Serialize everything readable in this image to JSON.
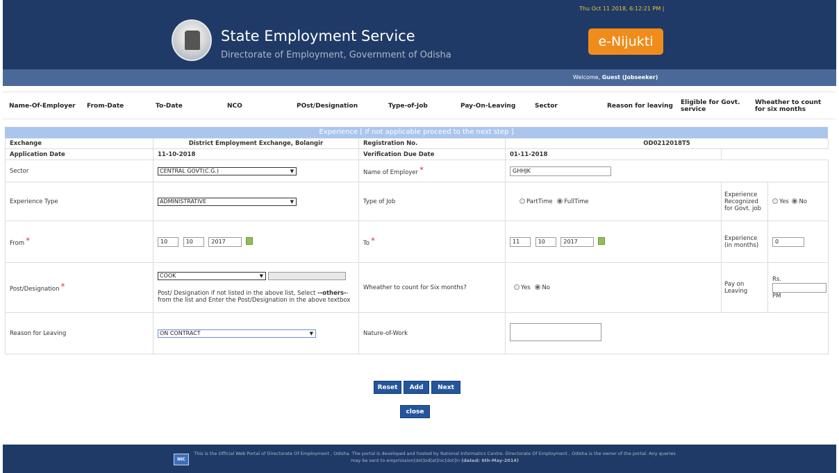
{
  "header": {
    "datetime": "Thu Oct 11 2018, 6:12:21 PM  |",
    "title": "State Employment Service",
    "subtitle": "Directorate of Employment, Government of Odisha",
    "brand": "e-Nijukti",
    "welcome_prefix": "Welcome, ",
    "welcome_user": "Guest (Jobseeker)"
  },
  "columns": [
    "Name-Of-Employer",
    "From-Date",
    "To-Date",
    "NCO",
    "POst/Designation",
    "Type-of-Job",
    "Pay-On-Leaving",
    "Sector",
    "Reason for leaving",
    "Eligible for Govt. service",
    "Wheather to count for six months"
  ],
  "banner": "Experience [ If not applicable proceed to the next step ]",
  "form": {
    "exchange_label": "Exchange",
    "exchange_value": "District Employment Exchange, Bolangir",
    "registration_label": "Registration No.",
    "registration_value": "OD0212018T5",
    "application_date_label": "Application Date",
    "application_date_value": "11-10-2018",
    "verification_label": "Verification Due Date",
    "verification_value": "01-11-2018",
    "sector_label": "Sector",
    "sector_value": "CENTRAL GOVT(C.G.)",
    "employer_label": "Name of Employer",
    "employer_value": "GHHJK",
    "exp_type_label": "Experience Type",
    "exp_type_value": "ADMINISTRATIVE",
    "job_type_label": "Type of Job",
    "parttime_label": "PartTime",
    "fulltime_label": "FullTime",
    "exp_recognized_label": "Experience Recognized for Govt. job",
    "yes_label": "Yes",
    "no_label": "No",
    "from_label": "From",
    "from_day": "10",
    "from_month": "10",
    "from_year": "2017",
    "to_label": "To",
    "to_day": "11",
    "to_month": "10",
    "to_year": "2017",
    "exp_months_label": "Experience (in months)",
    "exp_months_value": "0",
    "post_label": "Post/Designation",
    "post_value": "COOK",
    "post_hint_1": "Post/ Designation if not listed in the above list, Select ",
    "post_hint_bold": "--others-",
    "post_hint_2": "- from the list and Enter the Post/Designation in the above textbox",
    "six_months_label": "Wheather to count for Six months?",
    "pay_label": "Pay on Leaving",
    "rs_label": "Rs.",
    "pm_label": "PM",
    "reason_label": "Reason for Leaving",
    "reason_value": "ON CONTRACT",
    "nature_label": "Nature-of-Work"
  },
  "buttons": {
    "reset": "Reset",
    "add": "Add",
    "next": "Next",
    "close": "close"
  },
  "footer": {
    "logo": "NIC",
    "text": "This is the Official Web Portal of Directorate Of Employment , Odisha. The portal is developed and hosted by National Informatics Centre. Directorate Of Employment , Odisha is the owner of the portal. Any queries may be sent to empmission[dot]od[at]nic[dot]in ",
    "dated": "(dated: 6th-May-2014)"
  },
  "colors": {
    "header_bg": "#1f3a66",
    "welcome_bg": "#4a6999",
    "brand": "#ef8c1c",
    "banner": "#aac6ee",
    "button": "#24569c"
  },
  "icons": [
    "state-emblem-icon",
    "calendar-icon",
    "nic-logo-icon"
  ]
}
